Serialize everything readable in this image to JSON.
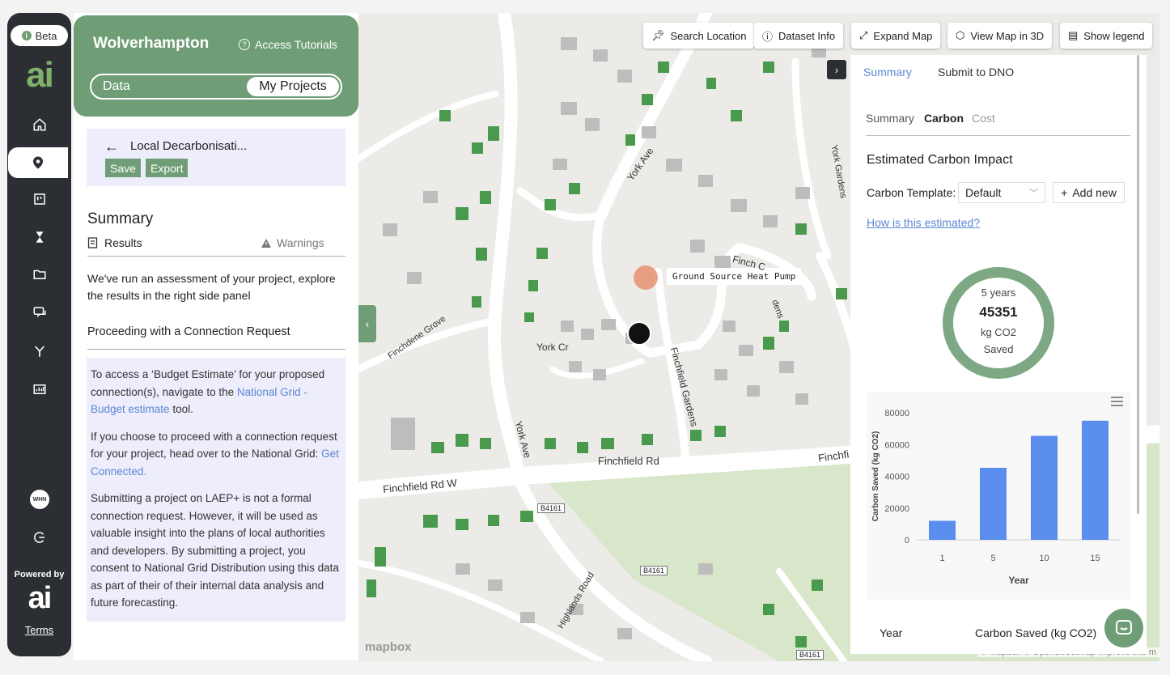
{
  "rail": {
    "beta": "Beta",
    "logo": "ai",
    "avatar": "WHN",
    "powered_by": "Powered by",
    "terms": "Terms"
  },
  "left_panel": {
    "city": "Wolverhampton",
    "tutorials": "Access Tutorials",
    "toggle": {
      "data": "Data",
      "projects": "My Projects"
    },
    "project_name": "Local Decarbonisati...",
    "save": "Save",
    "export": "Export",
    "summary_title": "Summary",
    "tab_results": "Results",
    "tab_warnings": "Warnings",
    "intro": "We've run an assessment of your project, explore the results in the right side panel",
    "proceeding": "Proceeding with a Connection Request",
    "info": {
      "p1_a": "To access a ‘Budget Estimate’ for your proposed connection(s), navigate to the ",
      "p1_link": "National Grid - Budget estimate",
      "p1_b": " tool.",
      "p2_a": "If you choose to proceed with a connection request for your project, head over to the National Grid: ",
      "p2_link": "Get Connected.",
      "p3": "Submitting a project on LAEP+ is not a formal connection request. However, it will be used as valuable insight into the plans of local authorities and developers. By submitting a project, you consent to National Grid Distribution using this data as part of their of their internal data analysis and future forecasting."
    }
  },
  "map": {
    "toolbar": {
      "search": "Search Location",
      "dataset": "Dataset Info",
      "expand": "Expand Map",
      "view3d": "View Map in 3D",
      "legend": "Show legend"
    },
    "marker_label": "Ground Source Heat Pump",
    "roads": {
      "york_ave_1": "York Ave",
      "york_ave_2": "York Ave",
      "york_cr": "York Cr",
      "finchfield_gardens": "Finchfield Gardens",
      "finchfield_rd": "Finchfield Rd",
      "finchfield_rd_w": "Finchfield Rd W",
      "finchfield_rd_e": "Finchfi",
      "finchdene_grove": "Finchdene Grove",
      "highlands_road": "Highlands Road",
      "york_gardens": "York Gardens",
      "finch_c": "Finch C",
      "dens": "dens",
      "b4161_a": "B4161",
      "b4161_b": "B4161",
      "b4161_c": "B4161"
    },
    "mapbox": "mapbox",
    "attribution": "© Mapbox © OpenStreetMap  Improve this m"
  },
  "right_panel": {
    "tabs": [
      "Summary",
      "Submit to DNO"
    ],
    "subtabs": [
      "Summary",
      "Carbon",
      "Cost"
    ],
    "title": "Estimated Carbon Impact",
    "template_label": "Carbon Template:",
    "template_value": "Default",
    "add_new": "Add new",
    "how": "How is this estimated?",
    "ring": {
      "period": "5 years",
      "value": "45351",
      "unit": "kg CO2",
      "label": "Saved"
    },
    "table_headers": [
      "Year",
      "Carbon Saved (kg CO2)"
    ]
  },
  "chart_data": {
    "type": "bar",
    "categories": [
      "1",
      "5",
      "10",
      "15"
    ],
    "values": [
      12000,
      45351,
      65500,
      75000
    ],
    "title": "",
    "xlabel": "Year",
    "ylabel": "Carbon Saved (kg CO2)",
    "ylim": [
      0,
      80000
    ],
    "yticks": [
      0,
      20000,
      40000,
      60000,
      80000
    ],
    "bar_color": "#5b8def",
    "grid": false
  },
  "colors": {
    "brand_green": "#6f9e76",
    "rail": "#2b2e33",
    "link": "#5b87d4",
    "building": "#b9b9b9",
    "building_green": "#4a9a4e"
  },
  "icons": [
    "home-icon",
    "location-pin-icon",
    "board-icon",
    "hourglass-icon",
    "folder-icon",
    "chat-icon",
    "fork-icon",
    "chart-icon",
    "logout-icon",
    "pin-icon",
    "info-icon",
    "expand-icon",
    "cube-icon",
    "legend-icon"
  ]
}
